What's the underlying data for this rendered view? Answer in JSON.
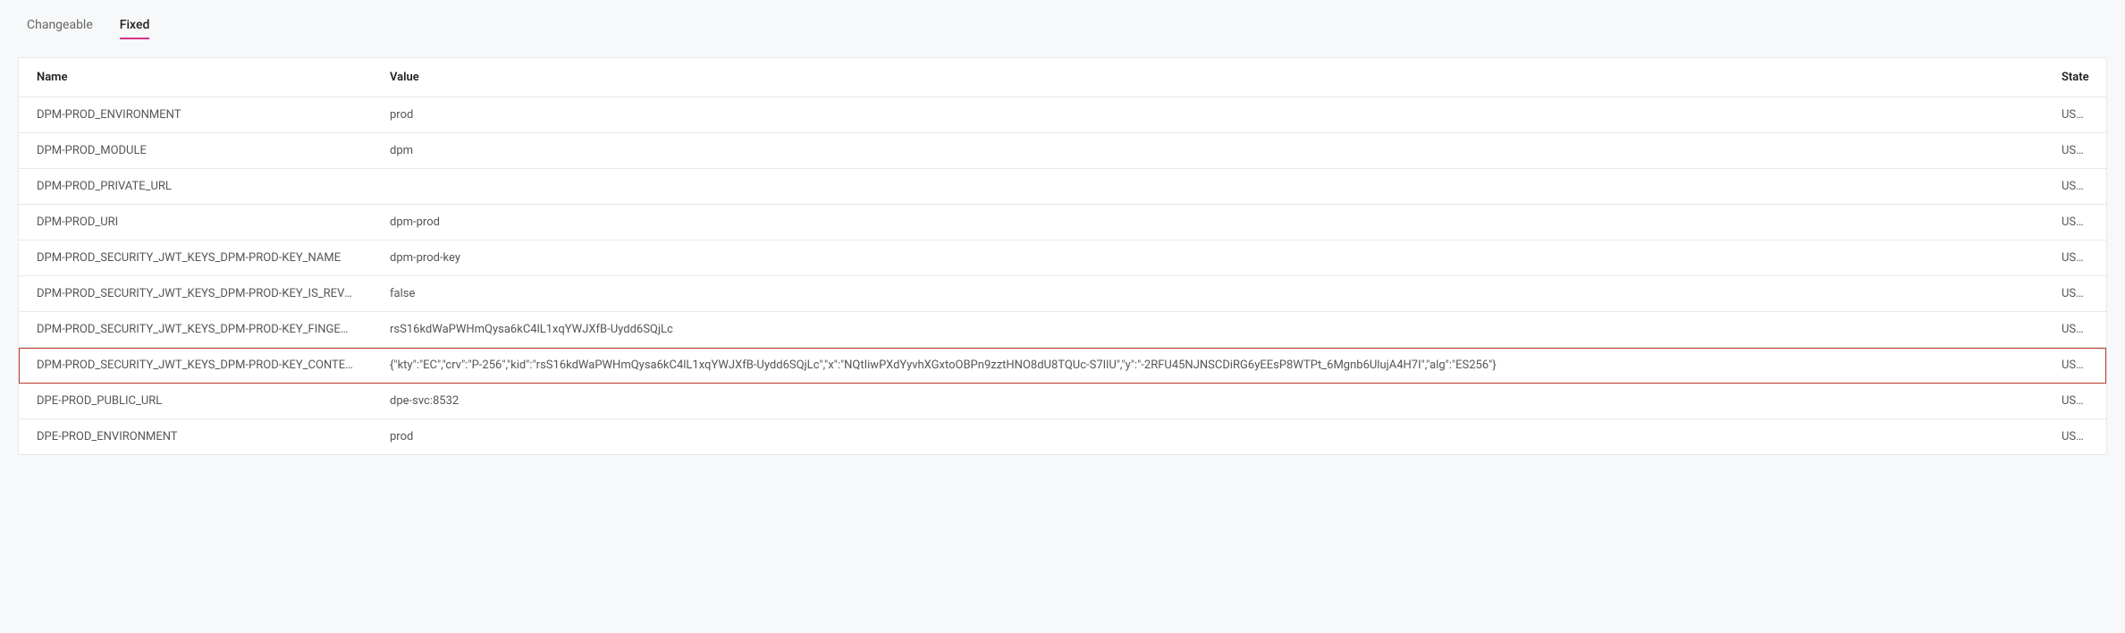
{
  "tabs": {
    "changeable": "Changeable",
    "fixed": "Fixed",
    "active": "fixed"
  },
  "table": {
    "headers": {
      "name": "Name",
      "value": "Value",
      "state": "State"
    },
    "rows": [
      {
        "name": "DPM-PROD_ENVIRONMENT",
        "value": "prod",
        "state": "USED",
        "highlighted": false
      },
      {
        "name": "DPM-PROD_MODULE",
        "value": "dpm",
        "state": "USED",
        "highlighted": false
      },
      {
        "name": "DPM-PROD_PRIVATE_URL",
        "value": "",
        "state": "USED",
        "highlighted": false
      },
      {
        "name": "DPM-PROD_URI",
        "value": "dpm-prod",
        "state": "USED",
        "highlighted": false
      },
      {
        "name": "DPM-PROD_SECURITY_JWT_KEYS_DPM-PROD-KEY_NAME",
        "value": "dpm-prod-key",
        "state": "USED",
        "highlighted": false
      },
      {
        "name": "DPM-PROD_SECURITY_JWT_KEYS_DPM-PROD-KEY_IS_REVOKED",
        "value": "false",
        "state": "USED",
        "highlighted": false
      },
      {
        "name": "DPM-PROD_SECURITY_JWT_KEYS_DPM-PROD-KEY_FINGERPRINT",
        "value": "rsS16kdWaPWHmQysa6kC4lL1xqYWJXfB-Uydd6SQjLc",
        "state": "USED",
        "highlighted": false
      },
      {
        "name": "DPM-PROD_SECURITY_JWT_KEYS_DPM-PROD-KEY_CONTENT",
        "value": "{\"kty\":\"EC\",\"crv\":\"P-256\",\"kid\":\"rsS16kdWaPWHmQysa6kC4lL1xqYWJXfB-Uydd6SQjLc\",\"x\":\"NQtIiwPXdYyvhXGxtoOBPn9zztHNO8dU8TQUc-S7IlU\",\"y\":\"-2RFU45NJNSCDiRG6yEEsP8WTPt_6Mgnb6UlujA4H7I\",\"alg\":\"ES256\"}",
        "state": "USED",
        "highlighted": true
      },
      {
        "name": "DPE-PROD_PUBLIC_URL",
        "value": "dpe-svc:8532",
        "state": "USED",
        "highlighted": false
      },
      {
        "name": "DPE-PROD_ENVIRONMENT",
        "value": "prod",
        "state": "USED",
        "highlighted": false
      }
    ]
  }
}
